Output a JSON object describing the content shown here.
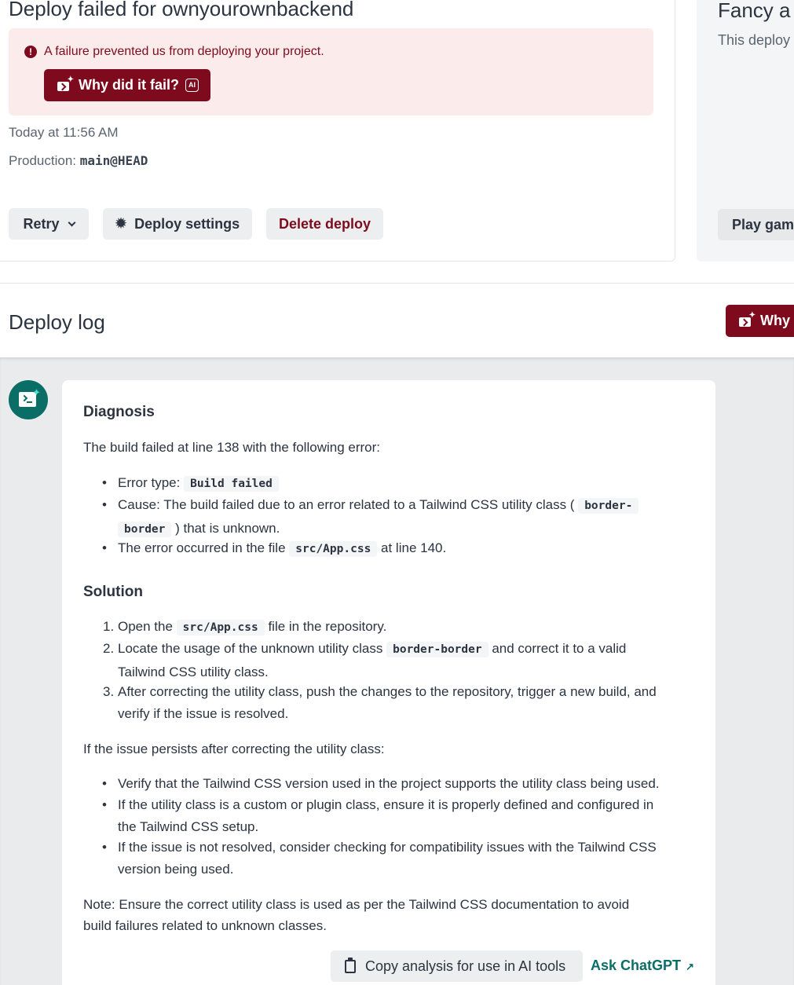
{
  "header": {
    "title": "Deploy failed for ownyourownbackend"
  },
  "alert": {
    "icon": "error-icon",
    "message": "A failure prevented us from deploying your project.",
    "why_button_label": "Why did it fail?",
    "ai_badge": "AI"
  },
  "meta": {
    "time": "Today at 11:56 AM",
    "production_label": "Production:",
    "branch": "main@HEAD"
  },
  "actions": {
    "retry_label": "Retry",
    "settings_label": "Deploy settings",
    "delete_label": "Delete deploy"
  },
  "side_card": {
    "title": "Fancy a g",
    "subtitle": "This deploy",
    "play_label": "Play game"
  },
  "deploy_log": {
    "title": "Deploy log",
    "why_button_label": "Why"
  },
  "diagnosis": {
    "heading": "Diagnosis",
    "intro": "The build failed at line 138 with the following error:",
    "bullets": {
      "b1_pre": "Error type: ",
      "b1_code": "Build failed",
      "b2_pre": "Cause: The build failed due to an error related to a Tailwind CSS utility class (",
      "b2_code_a": "border-",
      "b2_code_b": "border",
      "b2_post": ") that is unknown.",
      "b3_pre": "The error occurred in the file ",
      "b3_code": "src/App.css",
      "b3_post": " at line 140."
    },
    "solution_heading": "Solution",
    "steps": {
      "s1_num": "1.",
      "s1_pre": "Open the ",
      "s1_code": "src/App.css",
      "s1_post": " file in the repository.",
      "s2_num": "2.",
      "s2_pre": "Locate the usage of the unknown utility class ",
      "s2_code": "border-border",
      "s2_post": " and correct it to a valid",
      "s2_line2": "Tailwind CSS utility class.",
      "s3_num": "3.",
      "s3_line1": "After correcting the utility class, push the changes to the repository, trigger a new build, and",
      "s3_line2": "verify if the issue is resolved."
    },
    "persist_intro": "If the issue persists after correcting the utility class:",
    "persist": {
      "p1": "Verify that the Tailwind CSS version used in the project supports the utility class being used.",
      "p2_line1": "If the utility class is a custom or plugin class, ensure it is properly defined and configured in",
      "p2_line2": "the Tailwind CSS setup.",
      "p3_line1": "If the issue is not resolved, consider checking for compatibility issues with the Tailwind CSS",
      "p3_line2": "version being used."
    },
    "note_line1": "Note: Ensure the correct utility class is used as per the Tailwind CSS documentation to avoid",
    "note_line2": "build failures related to unknown classes.",
    "copy_label": "Copy analysis for use in AI tools",
    "ask_label": "Ask ChatGPT",
    "ask_icon": "↗"
  }
}
